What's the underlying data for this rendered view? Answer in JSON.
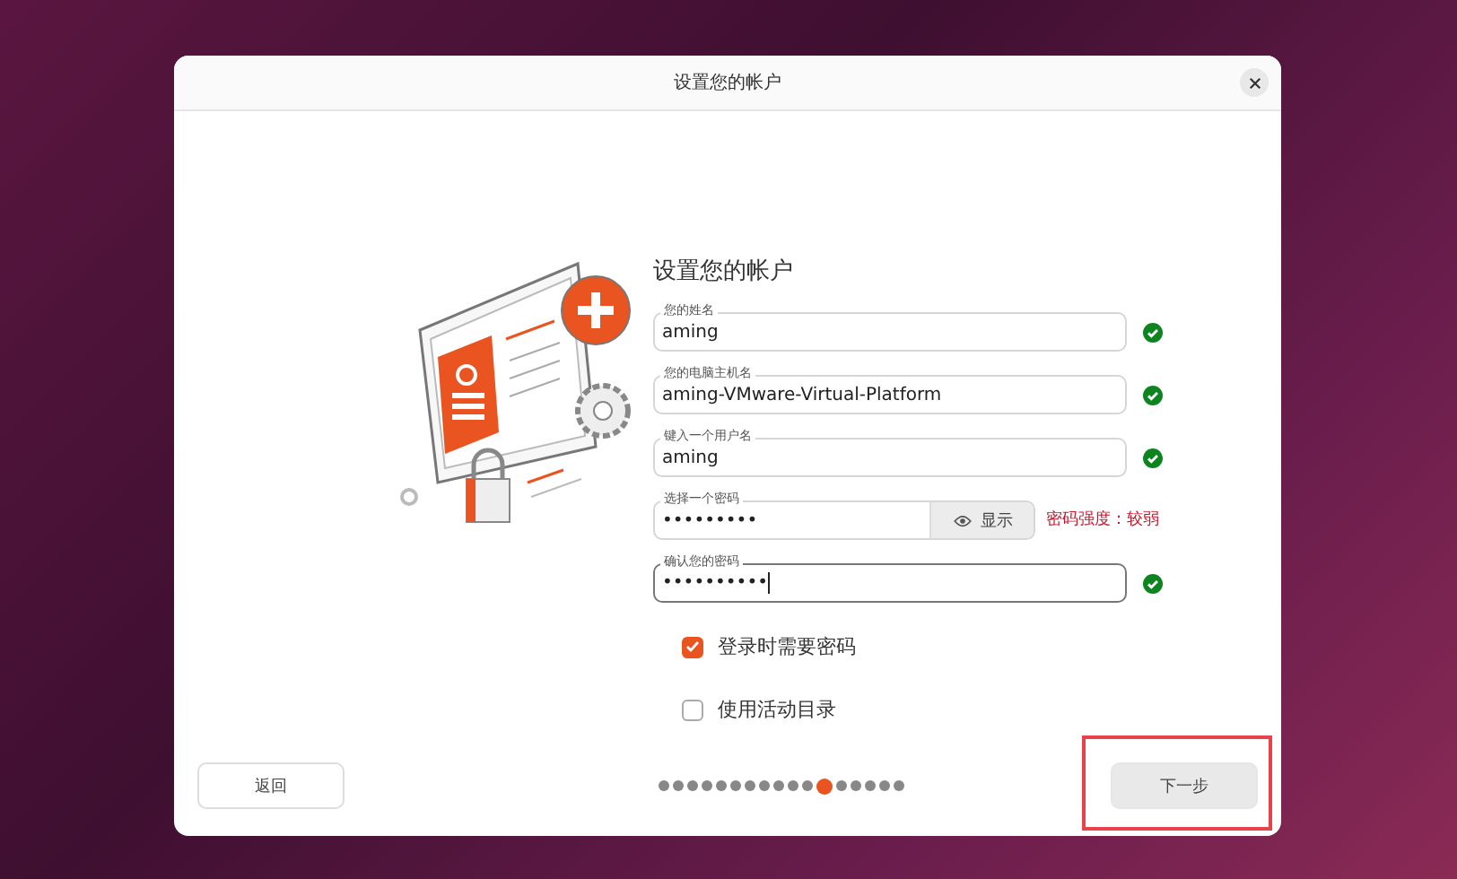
{
  "window": {
    "title": "设置您的帐户"
  },
  "heading": "设置您的帐户",
  "fields": [
    {
      "kind": "text",
      "label": "您的姓名",
      "value": "aming",
      "valid": true,
      "focused": false
    },
    {
      "kind": "text",
      "label": "您的电脑主机名",
      "value": "aming-VMware-Virtual-Platform",
      "valid": true,
      "focused": false
    },
    {
      "kind": "text",
      "label": "键入一个用户名",
      "value": "aming",
      "valid": true,
      "focused": false
    },
    {
      "kind": "password",
      "label": "选择一个密码",
      "value": "•••••••••",
      "valid": false,
      "focused": false,
      "reveal_button": "显示",
      "strength": "密码强度：较弱"
    },
    {
      "kind": "text",
      "label": "确认您的密码",
      "value": "••••••••••",
      "valid": true,
      "focused": true
    }
  ],
  "checkboxes": [
    {
      "label": "登录时需要密码",
      "checked": true
    },
    {
      "label": "使用活动目录",
      "checked": false
    }
  ],
  "back_button": "返回",
  "next_button": {
    "label": "下一步",
    "highlighted": true
  },
  "pager": [
    {
      "selected": false
    },
    {
      "selected": false
    },
    {
      "selected": false
    },
    {
      "selected": false
    },
    {
      "selected": false
    },
    {
      "selected": false
    },
    {
      "selected": false
    },
    {
      "selected": false
    },
    {
      "selected": false
    },
    {
      "selected": false
    },
    {
      "selected": false
    },
    {
      "selected": true
    },
    {
      "selected": false
    },
    {
      "selected": false
    },
    {
      "selected": false
    },
    {
      "selected": false
    },
    {
      "selected": false
    }
  ]
}
